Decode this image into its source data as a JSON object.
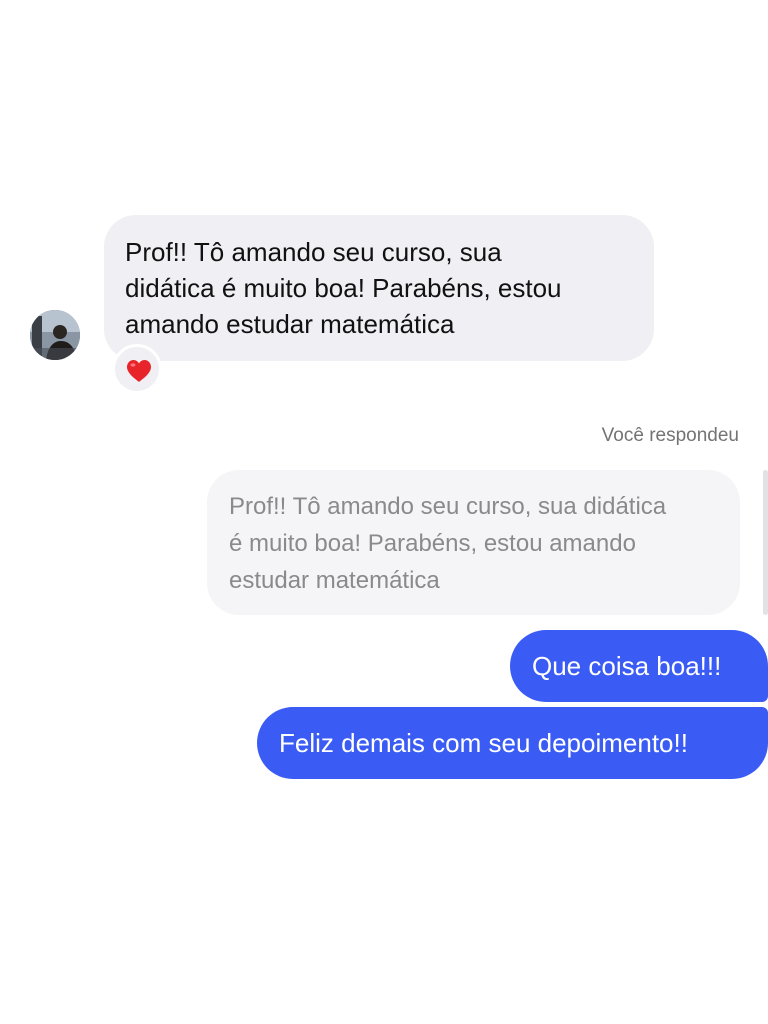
{
  "conversation": {
    "incoming_message": {
      "lines": [
        "Prof!! Tô amando seu curso, sua",
        "didática é muito boa! Parabéns, estou",
        "amando estudar matemática"
      ],
      "reaction_icon": "heart-emoji-icon"
    },
    "reply_context": {
      "label": "Você respondeu",
      "quoted_lines": [
        "Prof!! Tô amando seu curso, sua didática",
        "é muito boa! Parabéns, estou amando",
        "estudar matemática"
      ]
    },
    "outgoing_messages": [
      {
        "text": "Que coisa boa!!!"
      },
      {
        "text": "Feliz demais com seu depoimento!!"
      }
    ]
  },
  "colors": {
    "outgoing_bubble": "#3a5cf4",
    "incoming_bubble": "#efeff4",
    "quoted_bubble": "#f5f5f7",
    "reaction_heart": "#e8242b"
  }
}
